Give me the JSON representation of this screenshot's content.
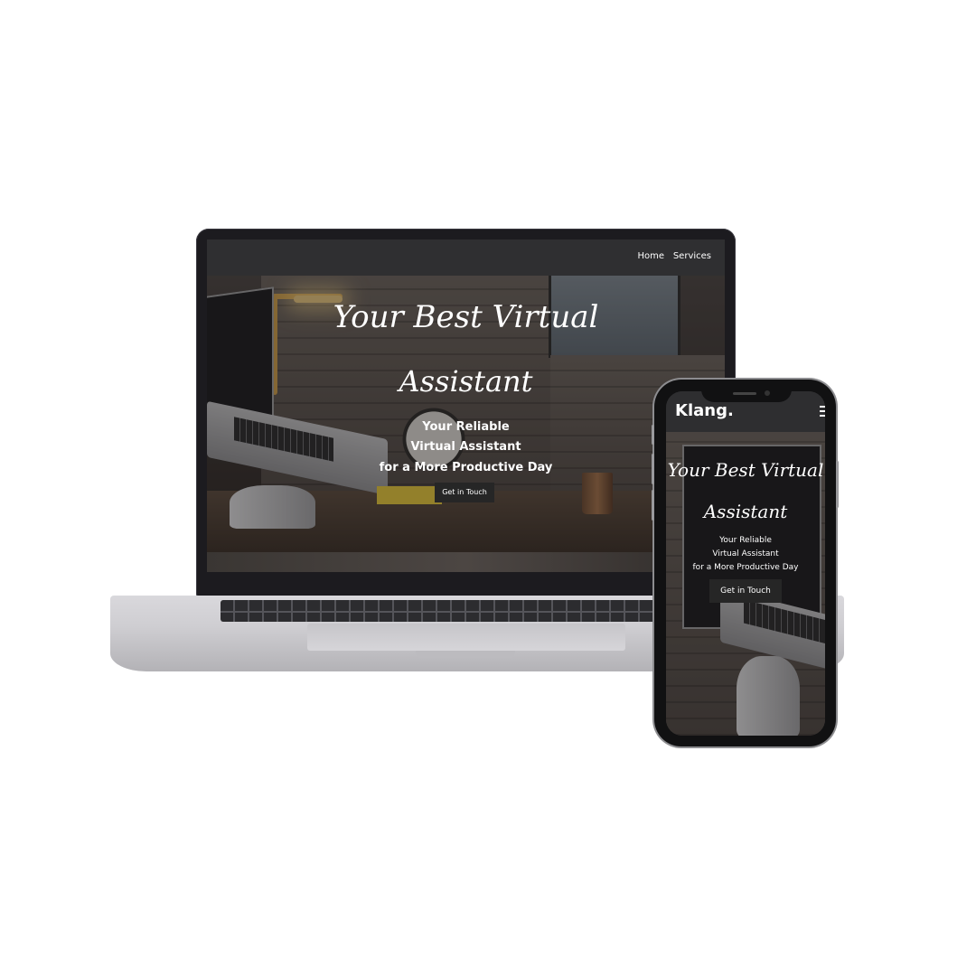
{
  "desktop": {
    "nav": {
      "links": [
        "Home",
        "Services"
      ]
    },
    "hero": {
      "title_line1": "Your Best Virtual",
      "title_line2": "Assistant",
      "subtitle_line1": "Your Reliable",
      "subtitle_line2": "Virtual Assistant",
      "subtitle_line3": "for a More Productive Day",
      "cta_label": "Get in Touch"
    }
  },
  "mobile": {
    "header": {
      "brand": "Klang.",
      "menu_icon": "hamburger-icon"
    },
    "hero": {
      "title_line1": "Your Best Virtual",
      "title_line2": "Assistant",
      "subtitle_line1": "Your Reliable",
      "subtitle_line2": "Virtual Assistant",
      "subtitle_line3": "for a More Productive Day",
      "cta_label": "Get in Touch"
    }
  },
  "colors": {
    "background": "#ffffff",
    "nav_bar": "#2f2f31",
    "text": "#ffffff",
    "cta_bg": "#262626",
    "device_frame": "#1c1b1f"
  }
}
